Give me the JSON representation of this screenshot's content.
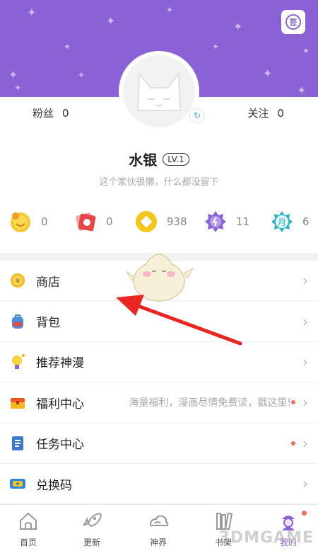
{
  "header": {
    "sign_icon": "sign-in-icon",
    "sign_label": "签"
  },
  "profile": {
    "fans_label": "粉丝",
    "fans_count": "0",
    "follow_label": "关注",
    "follow_count": "0",
    "username": "水银",
    "level": "LV.1",
    "bio": "这个家伙很懒，什么都没留下"
  },
  "assets": [
    {
      "icon": "smiley-medal-icon",
      "value": "0"
    },
    {
      "icon": "red-ticket-icon",
      "value": "0"
    },
    {
      "icon": "gold-coin-icon",
      "value": "938"
    },
    {
      "icon": "purple-gem-icon",
      "value": "11"
    },
    {
      "icon": "monthly-ticket-icon",
      "value": "6",
      "icon_text": "月"
    }
  ],
  "menu": [
    {
      "label": "商店",
      "icon": "shop-coin-icon",
      "desc": "",
      "dot": false
    },
    {
      "label": "背包",
      "icon": "backpack-icon",
      "desc": "",
      "dot": false
    },
    {
      "label": "推荐神漫",
      "icon": "recommend-icon",
      "desc": "",
      "dot": false
    },
    {
      "label": "福利中心",
      "icon": "treasure-chest-icon",
      "desc": "海量福利，漫画尽情免费读，戳这里!",
      "dot": true
    },
    {
      "label": "任务中心",
      "icon": "task-book-icon",
      "desc": "",
      "dot": true
    },
    {
      "label": "兑换码",
      "icon": "ticket-code-icon",
      "desc": "",
      "dot": false
    }
  ],
  "tabs": [
    {
      "label": "首页",
      "icon": "home-icon",
      "active": false
    },
    {
      "label": "更新",
      "icon": "rocket-icon",
      "active": false
    },
    {
      "label": "神界",
      "icon": "cloud-icon",
      "active": false
    },
    {
      "label": "书架",
      "icon": "bookshelf-icon",
      "active": false
    },
    {
      "label": "我的",
      "icon": "profile-icon",
      "active": true
    }
  ],
  "watermark": "3DMGAME",
  "colors": {
    "brand": "#8a62d6",
    "annotation_arrow": "#e8261f",
    "dot": "#f06b60"
  }
}
